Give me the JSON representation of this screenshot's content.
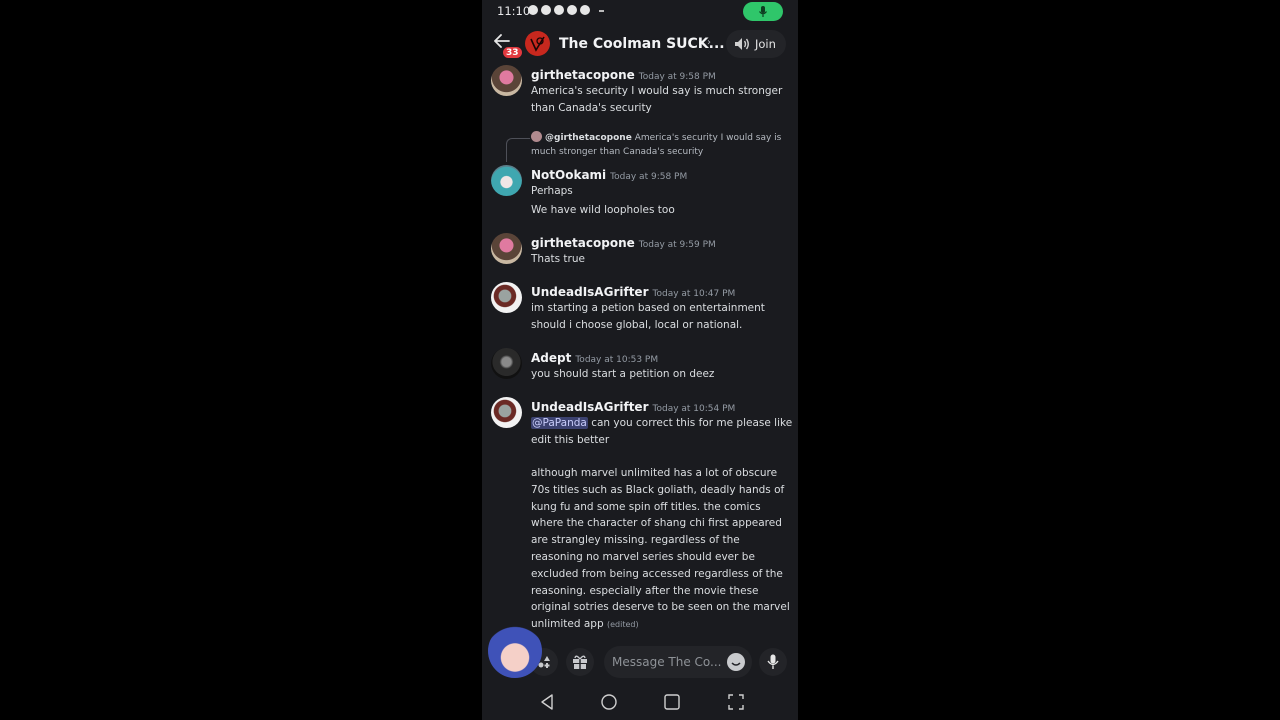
{
  "status_bar": {
    "time": "11:10",
    "notification_icons": [
      "chat-bubble-icon",
      "messenger-icon",
      "snapchat-icon",
      "snapchat-icon",
      "facebook-icon"
    ],
    "mic_active_color": "#2fc66a"
  },
  "header": {
    "back_label": "Back",
    "unread_badge": "33",
    "server_icon_color": "#c8281e",
    "channel_title": "The Coolman SUCK...",
    "join_label": "Join"
  },
  "messages": [
    {
      "author": "girthetacopone",
      "timestamp": "Today at 9:58 PM",
      "lines": [
        "America's security I would say is much stronger than Canada's security"
      ]
    },
    {
      "reply_to": {
        "author": "@girthetacopone",
        "text": "America's security I would say is much stronger than Canada's security"
      },
      "author": "NotOokami",
      "timestamp": "Today at 9:58 PM",
      "lines": [
        "Perhaps",
        "We have wild loopholes too"
      ]
    },
    {
      "author": "girthetacopone",
      "timestamp": "Today at 9:59 PM",
      "lines": [
        "Thats true"
      ]
    },
    {
      "author": "UndeadIsAGrifter",
      "timestamp": "Today at 10:47 PM",
      "lines": [
        "im starting a petion based on entertainment should i choose global, local or national."
      ]
    },
    {
      "author": "Adept",
      "timestamp": "Today at 10:53 PM",
      "lines": [
        "you should start a petition on deez"
      ]
    },
    {
      "author": "UndeadIsAGrifter",
      "timestamp": "Today at 10:54 PM",
      "mention": "@PaPanda",
      "lines": [
        "can you correct this for me please like edit this better",
        "although marvel unlimited has a lot of obscure 70s titles such as Black goliath, deadly hands of kung fu and some spin off titles. the comics where the character of shang chi first appeared are strangley missing. regardless of the reasoning no marvel series should ever be excluded from being accessed regardless of the reasoning. especially after the movie these original sotries deserve to be seen on the marvel unlimited app"
      ],
      "edited_label": "(edited)"
    }
  ],
  "composer": {
    "placeholder": "Message The Co..."
  },
  "nav": {
    "back": "back-triangle",
    "home": "home-circle",
    "recents": "recents-square",
    "screenshot": "screenshot-frame"
  }
}
